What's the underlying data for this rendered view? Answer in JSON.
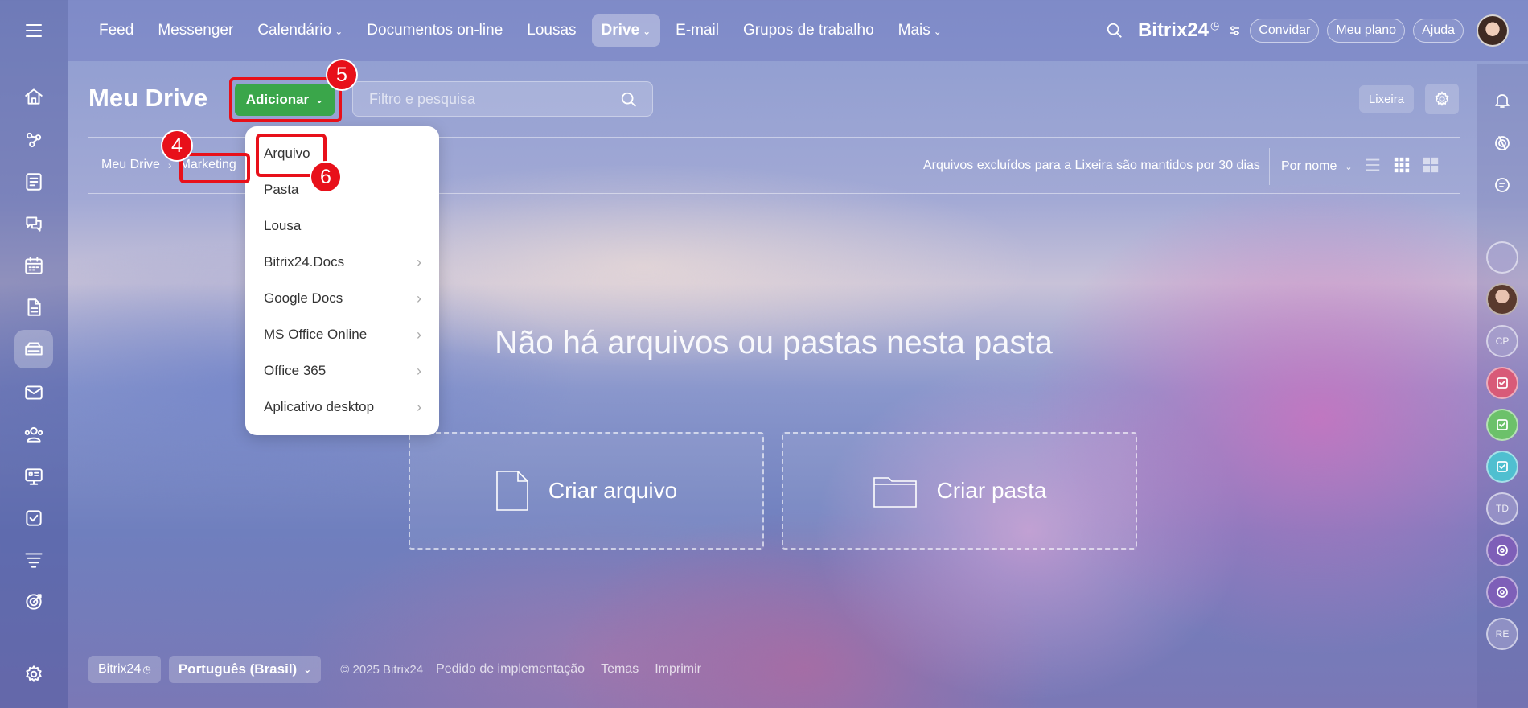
{
  "topbar": {
    "nav": [
      {
        "label": "Feed",
        "dropdown": false
      },
      {
        "label": "Messenger",
        "dropdown": false
      },
      {
        "label": "Calendário",
        "dropdown": true
      },
      {
        "label": "Documentos on-line",
        "dropdown": false
      },
      {
        "label": "Lousas",
        "dropdown": false
      },
      {
        "label": "Drive",
        "dropdown": true,
        "active": true
      },
      {
        "label": "E-mail",
        "dropdown": false
      },
      {
        "label": "Grupos de trabalho",
        "dropdown": false
      },
      {
        "label": "Mais",
        "dropdown": true
      }
    ],
    "brand": "Bitrix24",
    "invite_label": "Convidar",
    "plan_label": "Meu plano",
    "help_label": "Ajuda"
  },
  "header": {
    "title": "Meu Drive",
    "add_label": "Adicionar",
    "search_placeholder": "Filtro e pesquisa",
    "trash_label": "Lixeira"
  },
  "breadcrumb": {
    "items": [
      "Meu Drive",
      "Marketing"
    ]
  },
  "toolbar": {
    "info": "Arquivos excluídos para a Lixeira são mantidos por 30 dias",
    "sort_label": "Por nome"
  },
  "empty_state": {
    "message": "Não há arquivos ou pastas nesta pasta",
    "create_file": "Criar arquivo",
    "create_folder": "Criar pasta"
  },
  "dropdown": {
    "items": [
      {
        "label": "Arquivo",
        "submenu": false
      },
      {
        "label": "Pasta",
        "submenu": false
      },
      {
        "label": "Lousa",
        "submenu": false
      },
      {
        "label": "Bitrix24.Docs",
        "submenu": true
      },
      {
        "label": "Google Docs",
        "submenu": true
      },
      {
        "label": "MS Office Online",
        "submenu": true
      },
      {
        "label": "Office 365",
        "submenu": true
      },
      {
        "label": "Aplicativo desktop",
        "submenu": true
      }
    ]
  },
  "annotations": {
    "step4": "4",
    "step5": "5",
    "step6": "6",
    "color": "#e8101a"
  },
  "right_sidebar": {
    "initials": [
      "CP",
      "TD",
      "RE"
    ]
  },
  "footer": {
    "brand": "Bitrix24",
    "language": "Português (Brasil)",
    "copyright": "© 2025 Bitrix24",
    "links": [
      "Pedido de implementação",
      "Temas",
      "Imprimir"
    ]
  },
  "icons": {
    "left_sidebar": [
      "home-icon",
      "automation-icon",
      "feed-icon",
      "chat-icon",
      "calendar-icon",
      "document-icon",
      "drive-icon",
      "mail-icon",
      "contacts-icon",
      "sites-icon",
      "tasks-icon",
      "filter-icon",
      "target-icon",
      "settings-icon"
    ],
    "colors": {
      "add_button": "#3aa64a"
    }
  }
}
